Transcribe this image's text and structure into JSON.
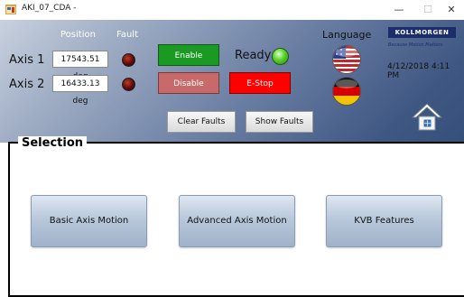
{
  "window": {
    "title": "AKI_07_CDA -",
    "minimize_label": "—",
    "maximize_label": "☐",
    "close_label": "✕"
  },
  "columns": {
    "position": "Position",
    "fault": "Fault"
  },
  "axes": [
    {
      "label": "Axis 1",
      "position": "17543.51 deg"
    },
    {
      "label": "Axis 2",
      "position": "16433.13 deg"
    }
  ],
  "controls": {
    "enable": "Enable",
    "disable": "Disable",
    "estop": "E-Stop",
    "ready": "Ready",
    "clear_faults": "Clear Faults",
    "show_faults": "Show Faults"
  },
  "language": {
    "label": "Language",
    "options": [
      "us-flag",
      "germany-flag"
    ]
  },
  "brand": {
    "name": "KOLLMORGEN",
    "tagline": "Because Motion Matters"
  },
  "datetime": "4/12/2018 4:11 PM",
  "selection": {
    "title": "Selection",
    "buttons": [
      "Basic Axis Motion",
      "Advanced Axis Motion",
      "KVB Features"
    ]
  },
  "colors": {
    "enable": "#1a9a22",
    "disable": "#c86a6a",
    "estop": "#ff0000",
    "ready_led": "#5ccf2e",
    "fault_led": "#5a0b08",
    "brand": "#1b2e6a"
  }
}
